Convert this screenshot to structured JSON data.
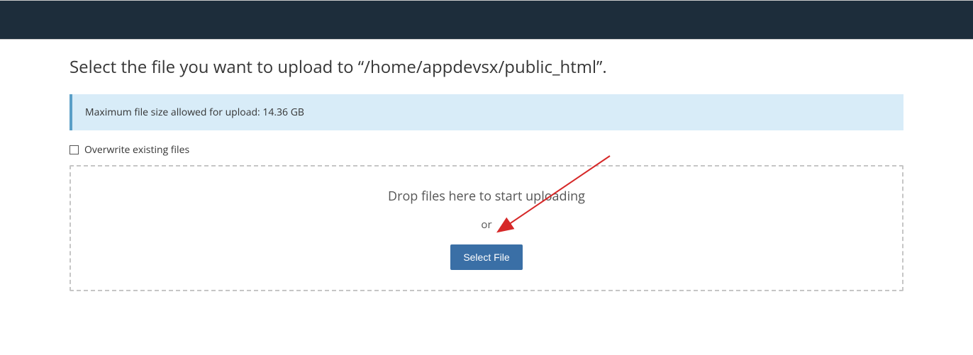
{
  "page": {
    "title": "Select the file you want to upload to “/home/appdevsx/public_html”."
  },
  "info_box": {
    "message": "Maximum file size allowed for upload: 14.36 GB"
  },
  "overwrite": {
    "label": "Overwrite existing files",
    "checked": false
  },
  "dropzone": {
    "drop_text": "Drop files here to start uploading",
    "or_text": "or",
    "button_label": "Select File"
  },
  "colors": {
    "header_bg": "#1d2d3b",
    "info_bg": "#d8ecf8",
    "info_border": "#5a9fc7",
    "button_bg": "#3a6fa6",
    "arrow": "#d62828"
  }
}
